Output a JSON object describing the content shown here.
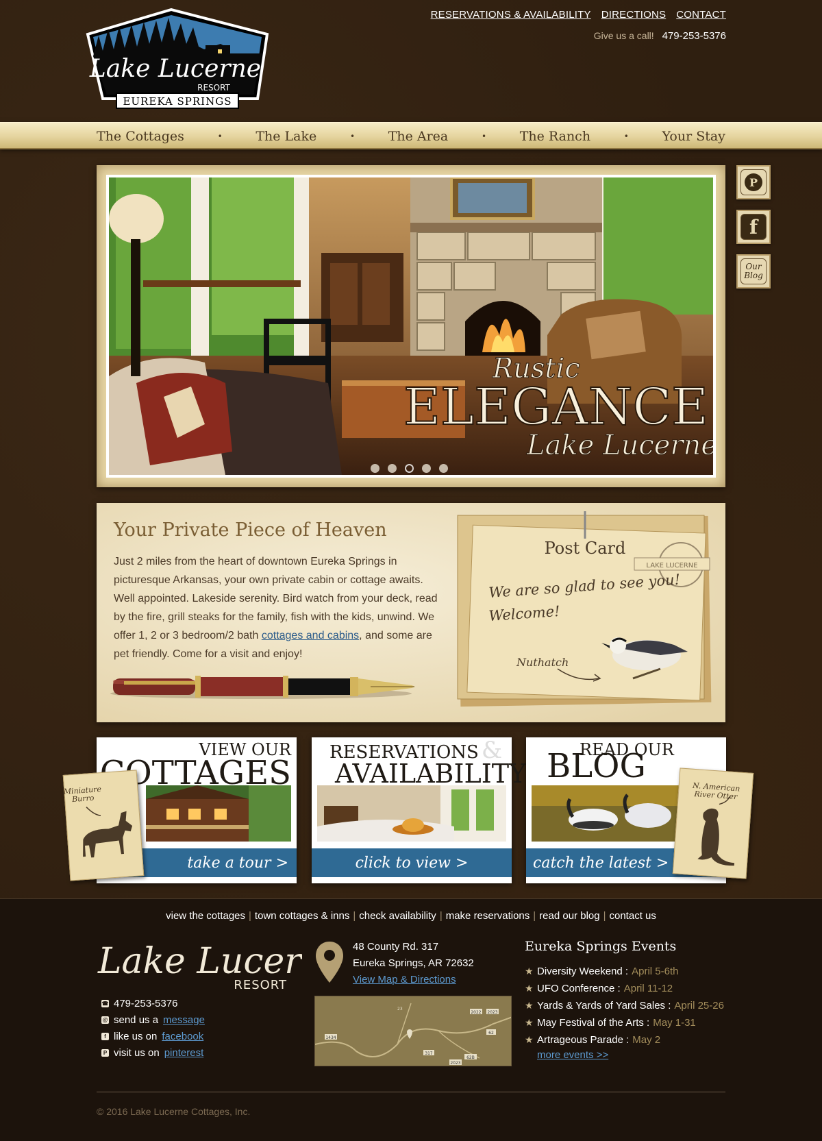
{
  "header": {
    "logo": {
      "name_line": "Lake Lucerne",
      "resort": "RESORT",
      "place": "EUREKA SPRINGS"
    },
    "top_links": [
      "RESERVATIONS & AVAILABILITY",
      "DIRECTIONS",
      "CONTACT"
    ],
    "call_label": "Give us a call!",
    "phone": "479-253-5376"
  },
  "nav": {
    "items": [
      "The Cottages",
      "The Lake",
      "The Area",
      "The Ranch",
      "Your Stay"
    ],
    "separator": "•"
  },
  "hero": {
    "overlay_line1": "Rustic",
    "overlay_line2": "ELEGANCE",
    "overlay_line3": "Lake Lucerne",
    "slide_count": 5,
    "active_slide": 3
  },
  "social": {
    "pinterest": "P",
    "facebook": "f",
    "blog": [
      "Our",
      "Blog"
    ]
  },
  "intro": {
    "heading": "Your Private Piece of Heaven",
    "body_before_link": "Just 2 miles from the heart of downtown Eureka Springs in picturesque Arkansas, your own private cabin or cottage awaits. Well appointed. Lakeside serenity. Bird watch from your deck, read by the fire, grill steaks for the family, fish with the kids, unwind. We offer 1, 2 or 3 bedroom/2 bath ",
    "link_text": "cottages and cabins",
    "body_after_link": ", and some are pet friendly. Come for a visit and enjoy!",
    "postcard": {
      "title": "Post Card",
      "stamp": "LAKE LUCERNE",
      "message_line1": "We are so glad to see you!",
      "message_line2": "Welcome!",
      "bird_label": "Nuthatch"
    }
  },
  "promos": [
    {
      "title_small": "VIEW OUR",
      "title_big": "COTTAGES",
      "cta": "take a tour  >",
      "card_label": "Miniature Burro"
    },
    {
      "title_small": "RESERVATIONS",
      "amp": "&",
      "title_big": "AVAILABILITY",
      "cta": "click to view  >"
    },
    {
      "title_small": "READ OUR",
      "title_big": "BLOG",
      "cta": "catch the latest  >",
      "card_label": "N. American River Otter"
    }
  ],
  "footer": {
    "links": [
      "view the cottages",
      "town cottages & inns",
      "check availability",
      "make reservations",
      "read our blog",
      "contact us"
    ],
    "logo": {
      "name": "Lake Lucerne",
      "resort": "RESORT"
    },
    "phone": "479-253-5376",
    "message_prefix": "send us a",
    "message_link": "message",
    "facebook_prefix": "like us on",
    "facebook_link": "facebook",
    "pinterest_prefix": "visit us on",
    "pinterest_link": "pinterest",
    "address_line1": "48 County Rd. 317",
    "address_line2": "Eureka Springs, AR  72632",
    "directions_link": "View Map & Directions",
    "map_labels": [
      "1434",
      "23",
      "62",
      "317",
      "62B",
      "2023",
      "2022",
      "2023"
    ],
    "events_title": "Eureka Springs Events",
    "events": [
      {
        "name": "Diversity Weekend :",
        "date": "April 5-6th"
      },
      {
        "name": "UFO Conference :",
        "date": "April 11-12"
      },
      {
        "name": "Yards & Yards of Yard Sales :",
        "date": "April 25-26"
      },
      {
        "name": "May Festival of the Arts :",
        "date": "May 1-31"
      },
      {
        "name": "Artrageous Parade :",
        "date": "May 2"
      }
    ],
    "more_events": "more events >>",
    "copyright": "© 2016 Lake Lucerne Cottages, Inc."
  },
  "colors": {
    "background": "#2f1f10",
    "nav_gold": "#e5d49e",
    "promo_blue": "#2f6a94",
    "link_blue": "#5d9ad0",
    "event_date": "#a48e5c"
  }
}
